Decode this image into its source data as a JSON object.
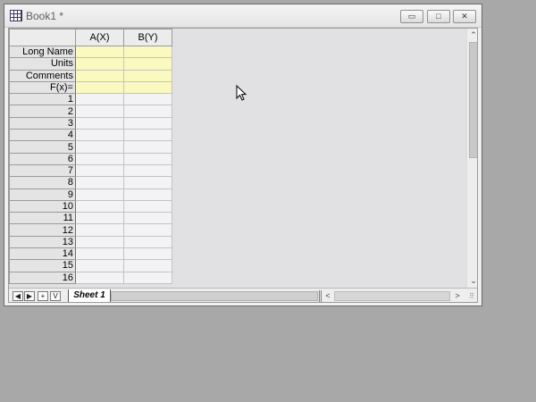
{
  "window": {
    "title": "Book1 *",
    "minimize_glyph": "▭",
    "maximize_glyph": "□",
    "close_glyph": "✕"
  },
  "columns": [
    "A(X)",
    "B(Y)"
  ],
  "label_rows": [
    "Long Name",
    "Units",
    "Comments",
    "F(x)="
  ],
  "data_rows": [
    "1",
    "2",
    "3",
    "4",
    "5",
    "6",
    "7",
    "8",
    "9",
    "10",
    "11",
    "12",
    "13",
    "14",
    "15",
    "16"
  ],
  "sheet_nav": {
    "first": "◀",
    "next": "▶",
    "add": "+",
    "v": "V"
  },
  "sheet_tab": "Sheet 1",
  "scroll": {
    "up": "⌃",
    "down": "⌄",
    "left": "<",
    "right": ">"
  },
  "colors": {
    "label_row_bg": "#fafac0",
    "cell_bg": "#f3f3f5",
    "desktop_bg": "#a9a8a9"
  }
}
